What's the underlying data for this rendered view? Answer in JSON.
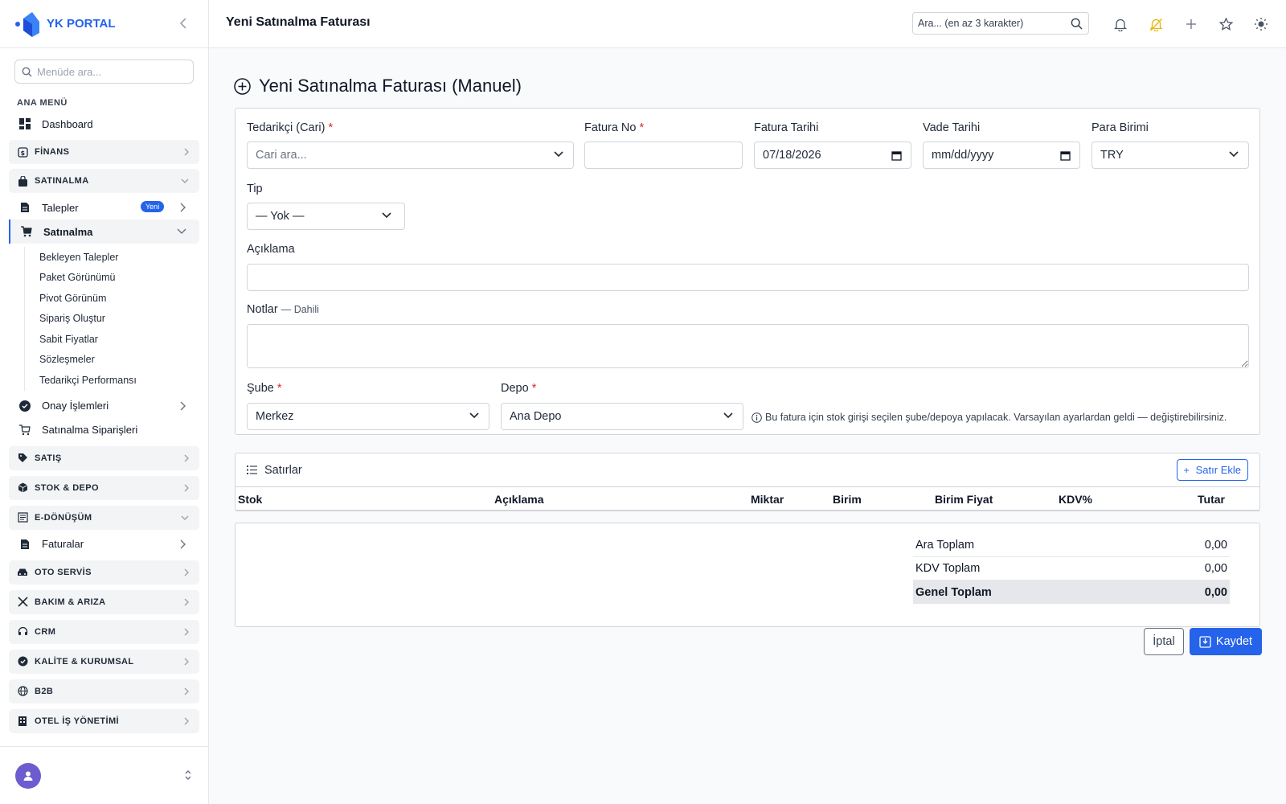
{
  "brand": {
    "name": "YK PORTAL",
    "accent": "#2563eb"
  },
  "sidebar": {
    "search_placeholder": "Menüde ara...",
    "section_label": "ANA MENÜ",
    "dashboard": "Dashboard",
    "groups": {
      "finans": "FİNANS",
      "satinalma": "SATINALMA",
      "satis": "SATIŞ",
      "stok": "STOK & DEPO",
      "edonusum": "E-DÖNÜŞÜM",
      "otoservis": "OTO SERVİS",
      "bakim": "BAKIM & ARIZA",
      "crm": "CRM",
      "kalite": "KALİTE & KURUMSAL",
      "b2b": "B2B",
      "otel": "OTEL İŞ YÖNETİMİ"
    },
    "talepler": "Talepler",
    "talepler_badge": "Yeni",
    "satinalma_item": "Satınalma",
    "satinalma_sub": [
      "Bekleyen Talepler",
      "Paket Görünümü",
      "Pivot Görünüm",
      "Sipariş Oluştur",
      "Sabit Fiyatlar",
      "Sözleşmeler",
      "Tedarikçi Performansı"
    ],
    "onay": "Onay İşlemleri",
    "siparisler": "Satınalma Siparişleri",
    "faturalar": "Faturalar"
  },
  "topbar": {
    "title": "Yeni Satınalma Faturası",
    "search_placeholder": "Ara... (en az 3 karakter)"
  },
  "page": {
    "heading": "Yeni Satınalma Faturası (Manuel)"
  },
  "form": {
    "supplier_label": "Tedarikçi (Cari)",
    "supplier_placeholder": "Cari ara...",
    "invoice_no_label": "Fatura No",
    "invoice_no_value": "",
    "invoice_date_label": "Fatura Tarihi",
    "invoice_date_value": "07/18/2026",
    "due_date_label": "Vade Tarihi",
    "due_date_value": "mm/dd/yyyy",
    "currency_label": "Para Birimi",
    "currency_value": "TRY",
    "type_label": "Tip",
    "type_value": "— Yok —",
    "description_label": "Açıklama",
    "description_value": "",
    "notes_label": "Notlar",
    "notes_hint": "— Dahili",
    "branch_label": "Şube",
    "branch_value": "Merkez",
    "warehouse_label": "Depo",
    "warehouse_value": "Ana Depo",
    "info_note": "Bu fatura için stok girişi seçilen şube/depoya yapılacak. Varsayılan ayarlardan geldi — değiştirebilirsiniz.",
    "required_mark": "*"
  },
  "lines": {
    "title": "Satırlar",
    "add_button": "Satır Ekle",
    "columns": [
      "Stok",
      "Açıklama",
      "Miktar",
      "Birim",
      "Birim Fiyat",
      "KDV%",
      "Tutar"
    ]
  },
  "totals": {
    "subtotal_label": "Ara Toplam",
    "subtotal_value": "0,00",
    "vat_label": "KDV Toplam",
    "vat_value": "0,00",
    "grand_label": "Genel Toplam",
    "grand_value": "0,00"
  },
  "actions": {
    "cancel": "İptal",
    "save": "Kaydet"
  }
}
